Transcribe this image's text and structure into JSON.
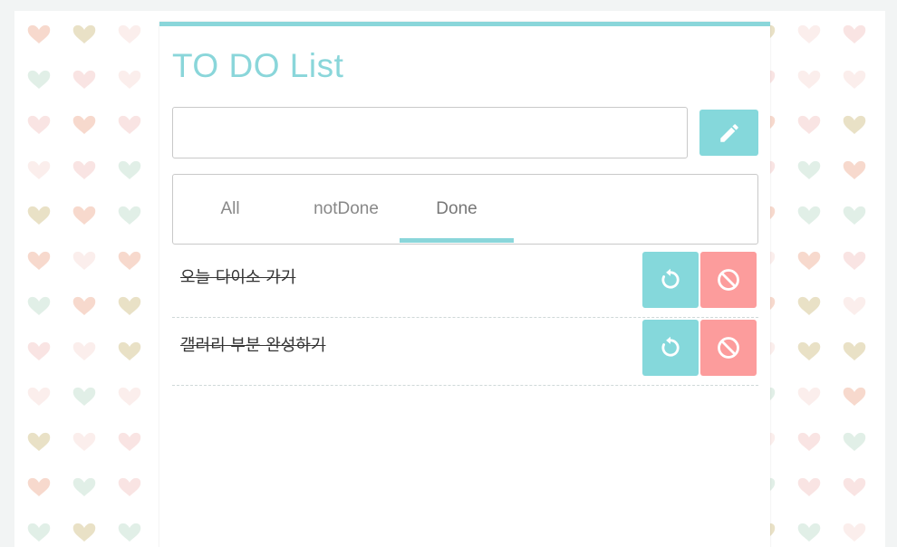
{
  "app": {
    "title": "TO DO List"
  },
  "input": {
    "value": "",
    "placeholder": "",
    "add_icon": "pencil-icon"
  },
  "tabs": [
    {
      "label": "All",
      "active": false
    },
    {
      "label": "notDone",
      "active": false
    },
    {
      "label": "Done",
      "active": true
    }
  ],
  "todos": [
    {
      "text": "오늘 다이소 가기",
      "done": true,
      "undo_icon": "undo-icon",
      "delete_icon": "block-icon"
    },
    {
      "text": "갤러리 부분 완성하기",
      "done": true,
      "undo_icon": "undo-icon",
      "delete_icon": "block-icon"
    }
  ],
  "colors": {
    "accent": "#8ad6da",
    "button_teal": "#85d8db",
    "button_red": "#fc9c9c",
    "heart_palette": [
      "#f7d9cd",
      "#f9e4e3",
      "#e9e1c6",
      "#e1efe7",
      "#fbeeec"
    ]
  }
}
